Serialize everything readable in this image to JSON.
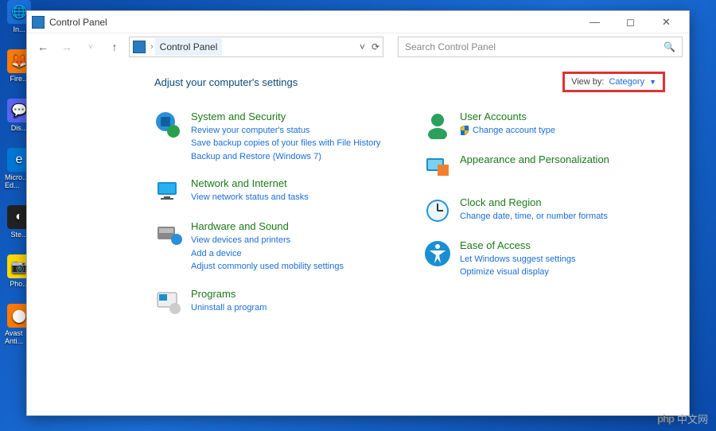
{
  "window": {
    "title": "Control Panel",
    "breadcrumb": "Control Panel",
    "search_placeholder": "Search Control Panel"
  },
  "content": {
    "heading": "Adjust your computer's settings",
    "view_by_label": "View by:",
    "view_by_value": "Category"
  },
  "left_col": [
    {
      "title": "System and Security",
      "links": [
        "Review your computer's status",
        "Save backup copies of your files with File History",
        "Backup and Restore (Windows 7)"
      ]
    },
    {
      "title": "Network and Internet",
      "links": [
        "View network status and tasks"
      ]
    },
    {
      "title": "Hardware and Sound",
      "links": [
        "View devices and printers",
        "Add a device",
        "Adjust commonly used mobility settings"
      ]
    },
    {
      "title": "Programs",
      "links": [
        "Uninstall a program"
      ]
    }
  ],
  "right_col": [
    {
      "title": "User Accounts",
      "links": [
        "Change account type"
      ],
      "shield": true
    },
    {
      "title": "Appearance and Personalization",
      "links": []
    },
    {
      "title": "Clock and Region",
      "links": [
        "Change date, time, or number formats"
      ]
    },
    {
      "title": "Ease of Access",
      "links": [
        "Let Windows suggest settings",
        "Optimize visual display"
      ]
    }
  ],
  "desktop": [
    {
      "label": "In...",
      "color": "#1a6ed8"
    },
    {
      "label": "Fire...",
      "color": "#ff7b00"
    },
    {
      "label": "Dis...",
      "color": "#5865f2"
    },
    {
      "label": "Micro...\nEd...",
      "color": "#0078d7"
    },
    {
      "label": "Ste...",
      "color": "#222"
    },
    {
      "label": "Pho...",
      "color": "#ffd900"
    },
    {
      "label": "Avast\nAnti...",
      "color": "#ff7b00"
    }
  ],
  "watermark": "中文网"
}
